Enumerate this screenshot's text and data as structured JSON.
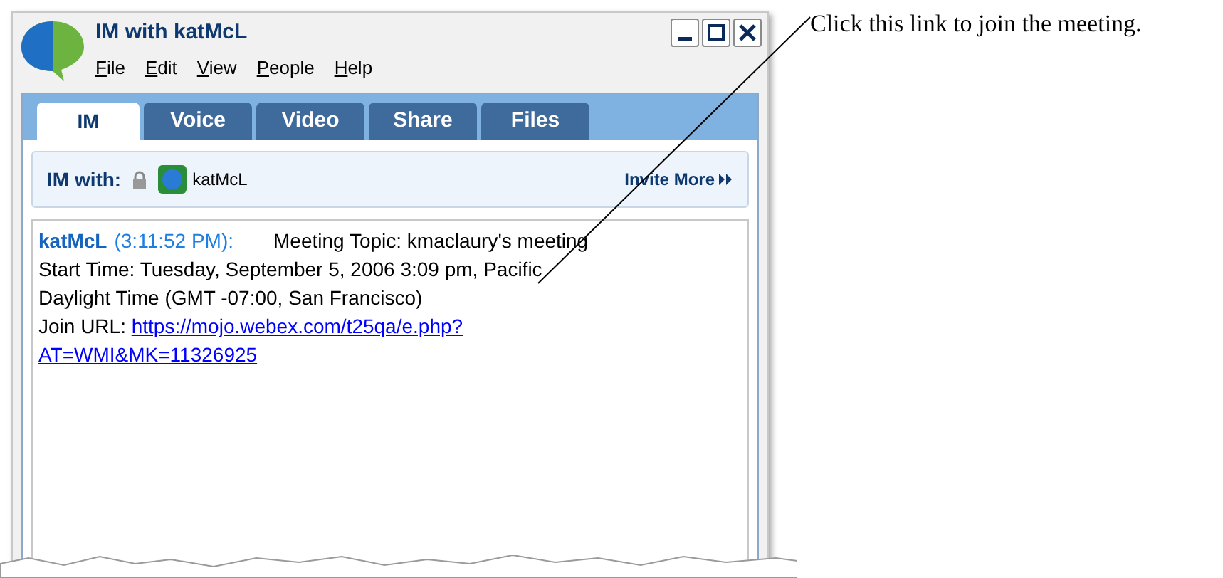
{
  "window": {
    "title": "IM with katMcL"
  },
  "menu": [
    {
      "label": "File"
    },
    {
      "label": "Edit"
    },
    {
      "label": "View"
    },
    {
      "label": "People"
    },
    {
      "label": "Help"
    }
  ],
  "tabs": [
    {
      "label": "IM",
      "selected": true
    },
    {
      "label": "Voice",
      "selected": false
    },
    {
      "label": "Video",
      "selected": false
    },
    {
      "label": "Share",
      "selected": false
    },
    {
      "label": "Files",
      "selected": false
    }
  ],
  "im_with": {
    "label": "IM with:",
    "contact": "katMcL",
    "invite": "Invite More"
  },
  "message": {
    "sender": "katMcL",
    "time": "(3:11:52 PM):",
    "text_lines": [
      "Meeting Topic: kmaclaury's meeting",
      "Start Time: Tuesday, September 5, 2006 3:09 pm, Pacific",
      "Daylight Time (GMT -07:00, San Francisco)"
    ],
    "join_label": "Join URL:",
    "url_lines": [
      "https://mojo.webex.com/t25qa/e.php?",
      "AT=WMI&MK=11326925"
    ]
  },
  "callout": "Click this link to join the meeting."
}
